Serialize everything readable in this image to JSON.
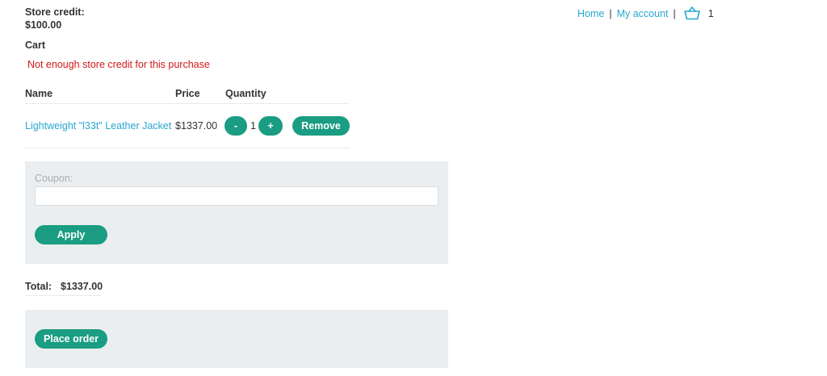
{
  "store_credit": {
    "label": "Store credit:",
    "value": "$100.00"
  },
  "cart": {
    "title": "Cart",
    "error": "Not enough store credit for this purchase",
    "columns": [
      "Name",
      "Price",
      "Quantity"
    ],
    "items": [
      {
        "name": "Lightweight \"l33t\" Leather Jacket",
        "price": "$1337.00",
        "quantity": "1",
        "minus_label": "-",
        "plus_label": "+",
        "remove_label": "Remove"
      }
    ]
  },
  "coupon": {
    "label": "Coupon:",
    "placeholder": "",
    "apply_label": "Apply"
  },
  "total": {
    "label": "Total:",
    "value": "$1337.00"
  },
  "order": {
    "place_order_label": "Place order"
  },
  "nav": {
    "home": "Home",
    "separator": "|",
    "my_account": "My account",
    "cart_count": "1"
  },
  "colors": {
    "accent": "#1a9d82",
    "link": "#29a7cf",
    "error": "#d21818",
    "panel": "#eaeef0"
  },
  "icons": {
    "cart": "basket-icon"
  }
}
